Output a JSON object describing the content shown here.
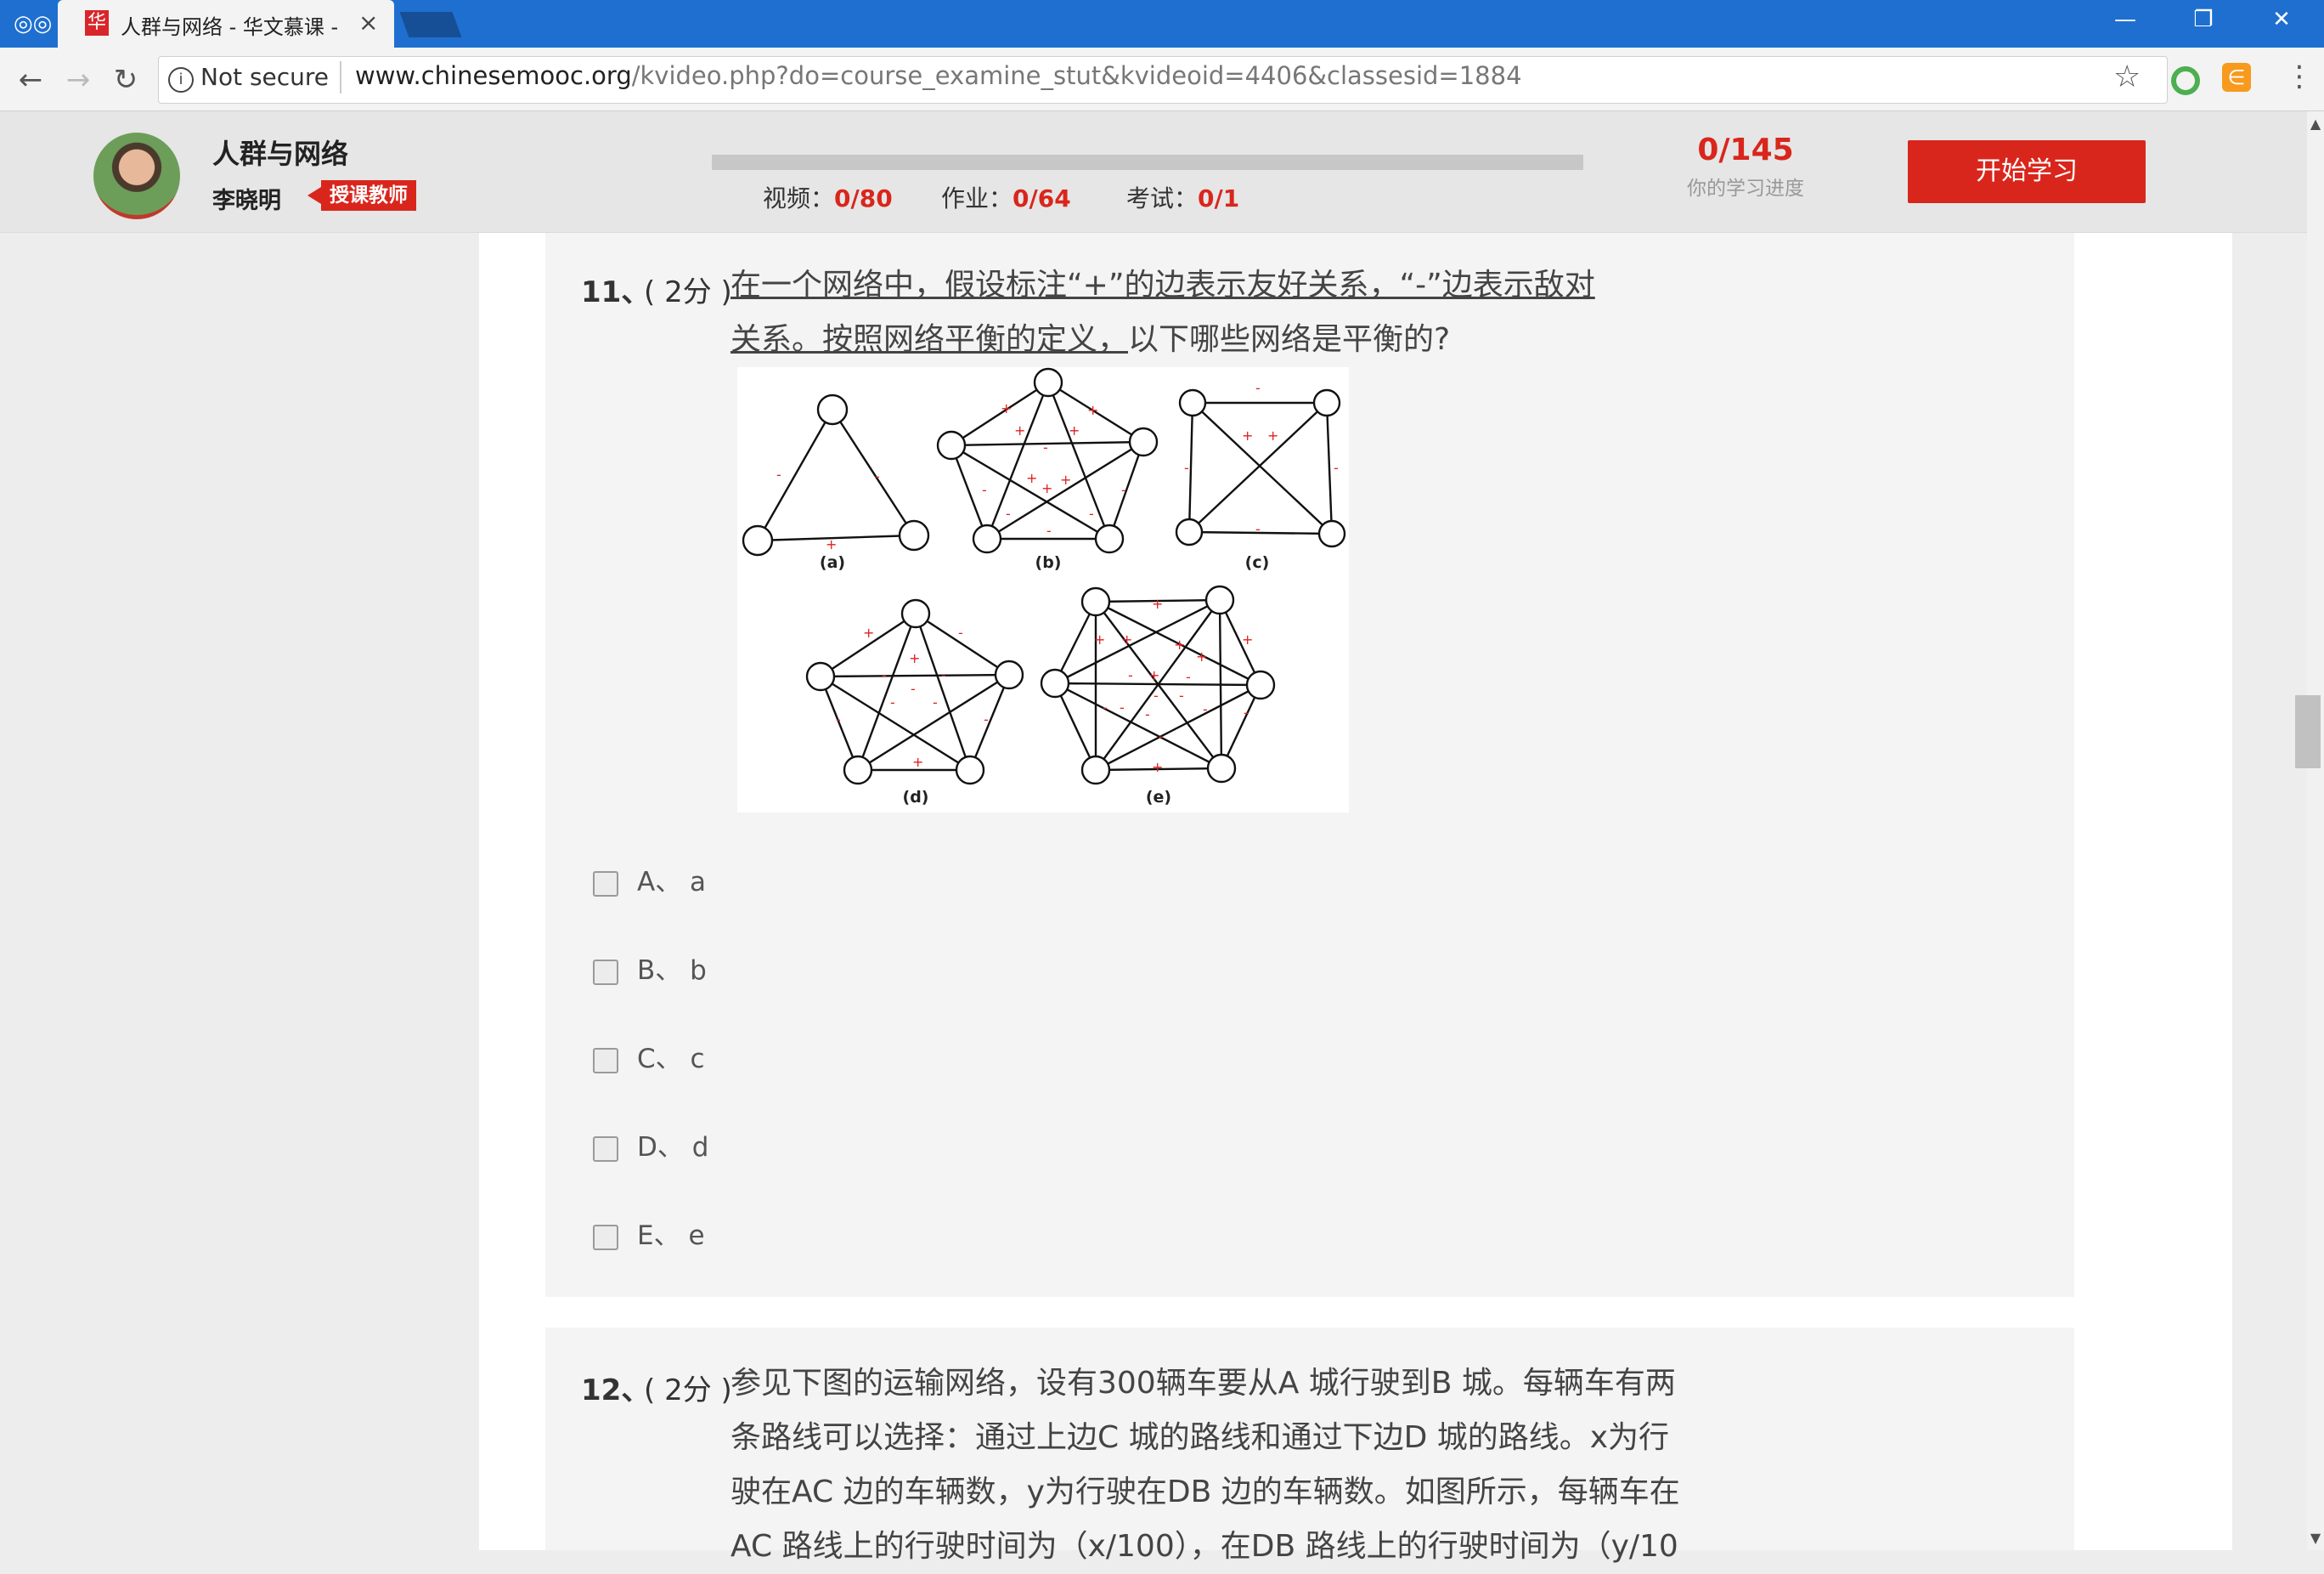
{
  "browser": {
    "tab_title": "人群与网络 - 华文慕课 -",
    "tab_favicon_text": "华",
    "security_label": "Not secure",
    "url_host": "www.chinesemooc.org",
    "url_path": "/kvideo.php?do=course_examine_stut&kvideoid=4406&classesid=1884"
  },
  "course": {
    "title": "人群与网络",
    "teacher": "李晓明",
    "teacher_badge": "授课教师",
    "progress_fraction": 0,
    "stats": {
      "video_label": "视频：",
      "video_value": "0/80",
      "homework_label": "作业：",
      "homework_value": "0/64",
      "exam_label": "考试：",
      "exam_value": "0/1"
    },
    "progress_total": "0/145",
    "progress_label": "你的学习进度",
    "start_button": "开始学习"
  },
  "questions": [
    {
      "number": "11、",
      "score": "( 2分 )",
      "text_line1": "在一个网络中，假设标注“+”的边表示友好关系，“-”边表示敌对",
      "text_line2a": "关系。按照网络平衡的定义，",
      "text_line2b": "以下哪些网络是平衡的?",
      "figure_labels": [
        "(a)",
        "(b)",
        "(c)",
        "(d)",
        "(e)"
      ],
      "options": [
        "A、 a",
        "B、 b",
        "C、 c",
        "D、 d",
        "E、 e"
      ]
    },
    {
      "number": "12、",
      "score": "( 2分 )",
      "lines": [
        "参见下图的运输网络，设有300辆车要从A 城行驶到B 城。每辆车有两",
        "条路线可以选择：通过上边C 城的路线和通过下边D 城的路线。x为行",
        "驶在AC 边的车辆数，y为行驶在DB 边的车辆数。如图所示，每辆车在",
        "AC 路线上的行驶时间为（x/100），在DB 路线上的行驶时间为（y/10"
      ]
    }
  ],
  "colors": {
    "accent": "#d9261c",
    "tabbar": "#1e6fd0"
  }
}
